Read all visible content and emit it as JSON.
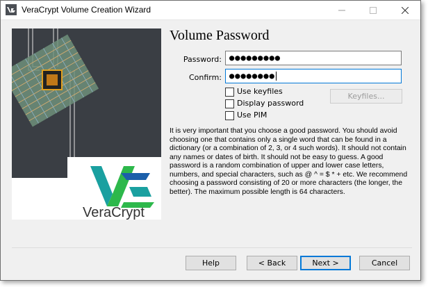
{
  "window": {
    "title": "VeraCrypt Volume Creation Wizard"
  },
  "logo": {
    "text": "VeraCrypt"
  },
  "page": {
    "heading": "Volume Password",
    "password_label": "Password:",
    "password_value": "●●●●●●●●●",
    "confirm_label": "Confirm:",
    "confirm_value": "●●●●●●●●",
    "use_keyfiles_label": "Use keyfiles",
    "display_password_label": "Display password",
    "use_pim_label": "Use PIM",
    "keyfiles_button": "Keyfiles...",
    "description": "It is very important that you choose a good password. You should avoid choosing one that contains only a single word that can be found in a dictionary (or a combination of 2, 3, or 4 such words). It should not contain any names or dates of birth. It should not be easy to guess. A good password is a random combination of upper and lower case letters, numbers, and special characters, such as @ ^ = $ * + etc. We recommend choosing a password consisting of 20 or more characters (the longer, the better). The maximum possible length is 64 characters."
  },
  "buttons": {
    "help": "Help",
    "back": "< Back",
    "next": "Next >",
    "cancel": "Cancel"
  },
  "colors": {
    "accent": "#0078d7",
    "logo_teal": "#1aa0a0",
    "logo_green": "#2db84b",
    "logo_blue": "#1b5faa"
  }
}
